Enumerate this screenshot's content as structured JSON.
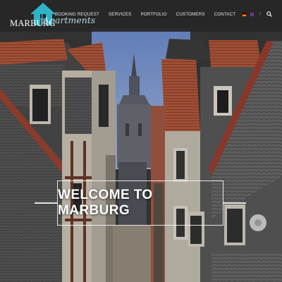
{
  "brand": {
    "name": "MARBURG",
    "tagline": "Apartments",
    "house_color": "#2fb3c7"
  },
  "nav": {
    "items": [
      {
        "label": "BOOKING REQUEST"
      },
      {
        "label": "SERVICES"
      },
      {
        "label": "PORTFOLIO"
      },
      {
        "label": "CUSTOMERS"
      },
      {
        "label": "CONTACT"
      }
    ],
    "languages": [
      "de-flag-icon",
      "en-flag-icon"
    ],
    "separator": "/",
    "search_icon": "search-icon"
  },
  "hero": {
    "headline": "WELCOME TO MARBURG"
  },
  "colors": {
    "navbar_bg": "#262626",
    "accent": "#2fb3c7",
    "roof": "#b5533a"
  }
}
